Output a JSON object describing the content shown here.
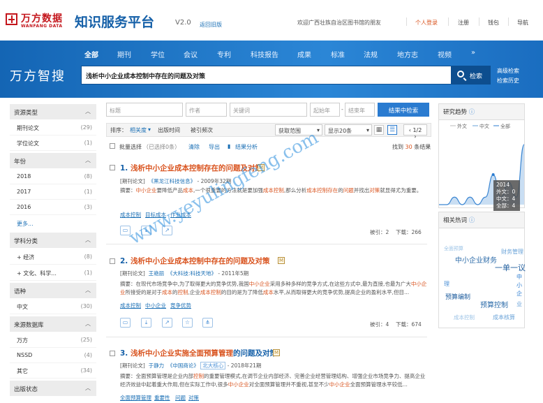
{
  "header": {
    "brand_cn": "万方数据",
    "brand_en": "WANFANG DATA",
    "platform": "知识服务平台",
    "version": "V2.0",
    "old_version": "返回旧版",
    "welcome": "欢迎广西壮族自治区图书馆的朋友",
    "links": [
      "个人登录",
      "注册",
      "钱包",
      "导航"
    ]
  },
  "nav": {
    "items": [
      "全部",
      "期刊",
      "学位",
      "会议",
      "专利",
      "科技报告",
      "成果",
      "标准",
      "法规",
      "地方志",
      "视频"
    ],
    "more": "»"
  },
  "search": {
    "title": "万方智搜",
    "query": "浅析中小企业成本控制中存在的问题及对策",
    "button": "检索",
    "advanced": "高级检索",
    "history": "检索历史"
  },
  "sidebar": {
    "groups": [
      {
        "title": "资源类型",
        "items": [
          {
            "label": "期刊论文",
            "count": "(29)"
          },
          {
            "label": "学位论文",
            "count": "(1)"
          }
        ]
      },
      {
        "title": "年份",
        "items": [
          {
            "label": "2018",
            "count": "(8)"
          },
          {
            "label": "2017",
            "count": "(1)"
          },
          {
            "label": "2016",
            "count": "(3)"
          }
        ],
        "more": "更多..."
      },
      {
        "title": "学科分类",
        "items": [
          {
            "label": "+ 经济",
            "count": "(8)"
          },
          {
            "label": "+ 文化、科学...",
            "count": "(1)"
          }
        ]
      },
      {
        "title": "语种",
        "items": [
          {
            "label": "中文",
            "count": "(30)"
          }
        ]
      },
      {
        "title": "来源数据库",
        "items": [
          {
            "label": "万方",
            "count": "(25)"
          },
          {
            "label": "NSSD",
            "count": "(4)"
          },
          {
            "label": "其它",
            "count": "(34)"
          }
        ]
      },
      {
        "title": "出版状态",
        "items": []
      }
    ]
  },
  "filters": {
    "title": "标题",
    "author": "作者",
    "keyword": "关键词",
    "start_year": "起始年",
    "end_year": "结束年",
    "button": "结果中检索",
    "dash": "-"
  },
  "toolbar": {
    "sort_label": "排序：",
    "relevance": "相关度",
    "pub_time": "出版时间",
    "cited": "被引频次",
    "range": "获取范围",
    "show": "显示20条",
    "page": "1/2",
    "prev": "‹",
    "next": "›"
  },
  "bar2": {
    "select_all": "批量选择",
    "selected": "（已选择0条）",
    "clear": "清除",
    "export": "导出",
    "analysis": "结果分析",
    "found": "找到",
    "count": "30",
    "unit": "条结果"
  },
  "results": [
    {
      "num": "1.",
      "title_hl": "浅析中小企业成本控制存在的问题及对策",
      "type": "[期刊论文]",
      "source": "《黑龙江科技信息》",
      "year": "- 2009年32期",
      "abstract": "摘要：中小企业要降低产品成本,一个很重要的方法就是要加强成本控制,那么分析成本控制存在的问题并找出对策就显得尤为重要。",
      "keywords": [
        "成本控制",
        "目标成本",
        "作业成本"
      ],
      "cited": "被引：2",
      "downloads": "下载：266"
    },
    {
      "num": "2.",
      "title_hl": "浅析中小企业成本控制中存在的问题及对策",
      "type": "[期刊论文]",
      "author": "王艳丽",
      "source": "《大科技:科技天地》",
      "year": "- 2011年5期",
      "abstract": "摘要：在现代市场竞争中,为了取得更大的竞争优势,我国中小企业采用多种多样的竞争方式,在这些方式中,最为直接,也最为广大中小企业所接受的是对于成本的控制,企业成本控制的目的是为了降低成本水平,从而取得更大的竞争优势,提高企业的盈利水平,但目...",
      "keywords": [
        "成本控制",
        "中小企业",
        "竞争优势"
      ],
      "cited": "被引：4",
      "downloads": "下载：674"
    },
    {
      "num": "3.",
      "title_pre": "浅析中小企业实施全面预算管理",
      "title_post": "的问题及对策",
      "type": "[期刊论文]",
      "author": "于静力",
      "source": "《中国商论》",
      "tag": "北大核心",
      "year": "- 2018年21期",
      "abstract": "摘要：全面预算管理是企业内部控制的重要管理模式,在调节企业内部经济、完善企业经营管理结构、增强企业市场竞争力、提高企业经济效益中起着重大作用,但在实际工作中,很多中小企业对全面预算管理并不重视,甚至不少中小企业全面预算管理水平较低...",
      "keywords": [
        "全面预算管理",
        "重要性",
        "问题",
        "对策"
      ]
    }
  ],
  "badge": "M",
  "trend": {
    "title": "研究趋势",
    "legend": [
      "外文",
      "中文",
      "全部"
    ],
    "tooltip": {
      "year": "2014",
      "foreign": "外文：0",
      "chinese": "中文：4",
      "total": "全部：4"
    }
  },
  "chart_data": {
    "type": "area",
    "series": [
      {
        "name": "全部",
        "x": [
          2007,
          2008,
          2009,
          2010,
          2011,
          2012,
          2013,
          2014,
          2015,
          2016,
          2017,
          2018
        ],
        "values": [
          0,
          0,
          1,
          0,
          1,
          0,
          1,
          4,
          1,
          3,
          1,
          8
        ]
      }
    ],
    "legend": [
      "外文",
      "中文",
      "全部"
    ]
  },
  "hot": {
    "title": "相关热词",
    "words": [
      "全面预算",
      "中小企业财务",
      "财务管理",
      "一单一议",
      "中小企",
      "理",
      "预算编制",
      "预算控制",
      "业",
      "成本控制",
      "成本核算"
    ]
  },
  "watermark": "www.yeyulingfeng.com",
  "colors": {
    "accent": "#1a6fb5",
    "brand": "#c4161c",
    "highlight": "#d9531e",
    "band": "#1a73c8"
  }
}
